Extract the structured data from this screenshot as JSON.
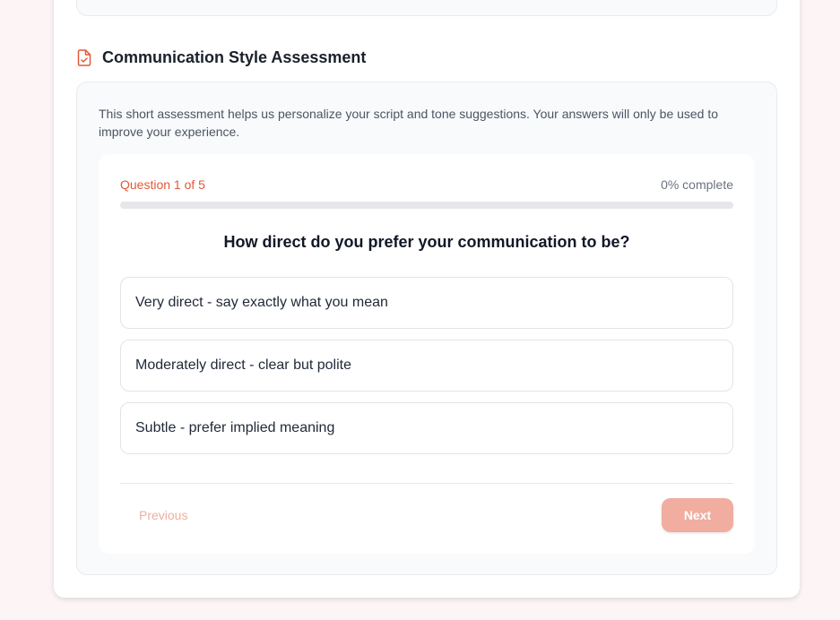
{
  "section": {
    "title": "Communication Style Assessment",
    "icon": "file-check-icon",
    "icon_color": "#e05a3a"
  },
  "intro": "This short assessment helps us personalize your script and tone suggestions. Your answers will only be used to improve your experience.",
  "quiz": {
    "counter": "Question 1 of 5",
    "progress_label": "0% complete",
    "progress_fraction": 0,
    "question": "How direct do you prefer your communication to be?",
    "options": [
      "Very direct - say exactly what you mean",
      "Moderately direct - clear but polite",
      "Subtle - prefer implied meaning"
    ],
    "previous_label": "Previous",
    "next_label": "Next"
  },
  "colors": {
    "accent": "#e05a3a",
    "accent_muted": "#f0ada0",
    "page_background": "#fcf4f5"
  }
}
